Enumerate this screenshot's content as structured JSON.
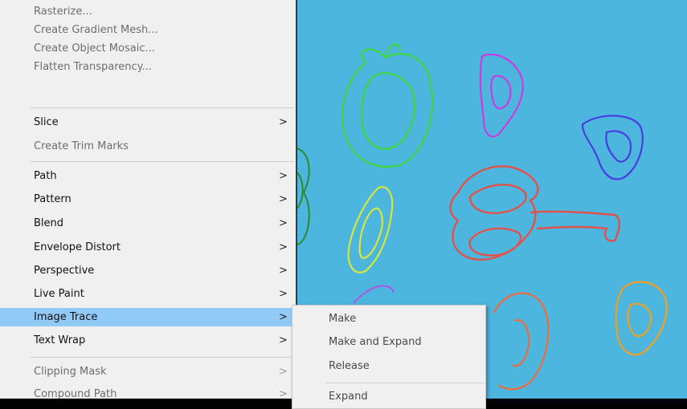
{
  "menu": {
    "items_top": [
      {
        "label": "Rasterize...",
        "enabled": false
      },
      {
        "label": "Create Gradient Mesh...",
        "enabled": false
      },
      {
        "label": "Create Object Mosaic...",
        "enabled": false
      },
      {
        "label": "Flatten Transparency...",
        "enabled": false
      }
    ],
    "slice": {
      "label": "Slice",
      "arrow": ">"
    },
    "create_trim_marks": {
      "label": "Create Trim Marks"
    },
    "path": {
      "label": "Path",
      "arrow": ">"
    },
    "pattern": {
      "label": "Pattern",
      "arrow": ">"
    },
    "blend": {
      "label": "Blend",
      "arrow": ">"
    },
    "envelope_distort": {
      "label": "Envelope Distort",
      "arrow": ">"
    },
    "perspective": {
      "label": "Perspective",
      "arrow": ">"
    },
    "live_paint": {
      "label": "Live Paint",
      "arrow": ">"
    },
    "image_trace": {
      "label": "Image Trace",
      "arrow": ">"
    },
    "text_wrap": {
      "label": "Text Wrap",
      "arrow": ">"
    },
    "clipping_mask": {
      "label": "Clipping Mask",
      "arrow": ">"
    },
    "compound_path": {
      "label": "Compound Path",
      "arrow": ">"
    }
  },
  "submenu": {
    "make": "Make",
    "make_and_expand": "Make and Expand",
    "release": "Release",
    "expand": "Expand"
  },
  "colors": {
    "canvas_bg": "#4db6df",
    "menu_bg": "#f0f0f0",
    "highlight": "#91c9f7"
  }
}
